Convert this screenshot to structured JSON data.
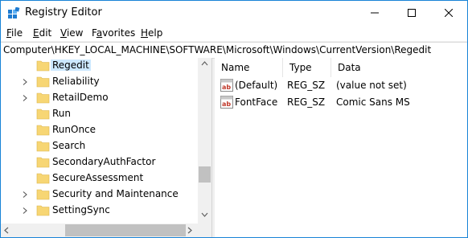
{
  "window": {
    "title": "Registry Editor"
  },
  "menu": [
    {
      "label": "File",
      "access_key": "F"
    },
    {
      "label": "Edit",
      "access_key": "E"
    },
    {
      "label": "View",
      "access_key": "V"
    },
    {
      "label": "Favorites",
      "access_key": "a"
    },
    {
      "label": "Help",
      "access_key": "H"
    }
  ],
  "address": "Computer\\HKEY_LOCAL_MACHINE\\SOFTWARE\\Microsoft\\Windows\\CurrentVersion\\Regedit",
  "tree": {
    "items": [
      {
        "label": "Regedit",
        "expandable": false,
        "selected": true
      },
      {
        "label": "Reliability",
        "expandable": true,
        "selected": false
      },
      {
        "label": "RetailDemo",
        "expandable": true,
        "selected": false
      },
      {
        "label": "Run",
        "expandable": false,
        "selected": false
      },
      {
        "label": "RunOnce",
        "expandable": false,
        "selected": false
      },
      {
        "label": "Search",
        "expandable": false,
        "selected": false
      },
      {
        "label": "SecondaryAuthFactor",
        "expandable": false,
        "selected": false
      },
      {
        "label": "SecureAssessment",
        "expandable": false,
        "selected": false
      },
      {
        "label": "Security and Maintenance",
        "expandable": true,
        "selected": false
      },
      {
        "label": "SettingSync",
        "expandable": true,
        "selected": false
      }
    ]
  },
  "list": {
    "columns": {
      "name": "Name",
      "type": "Type",
      "data": "Data"
    },
    "rows": [
      {
        "name": "(Default)",
        "type": "REG_SZ",
        "data": "(value not set)",
        "icon": "string-value-icon"
      },
      {
        "name": "FontFace",
        "type": "REG_SZ",
        "data": "Comic Sans MS",
        "icon": "string-value-icon"
      }
    ]
  },
  "colors": {
    "accent": "#1883d7",
    "selection": "#cce8ff",
    "folder": "#f7d674"
  }
}
